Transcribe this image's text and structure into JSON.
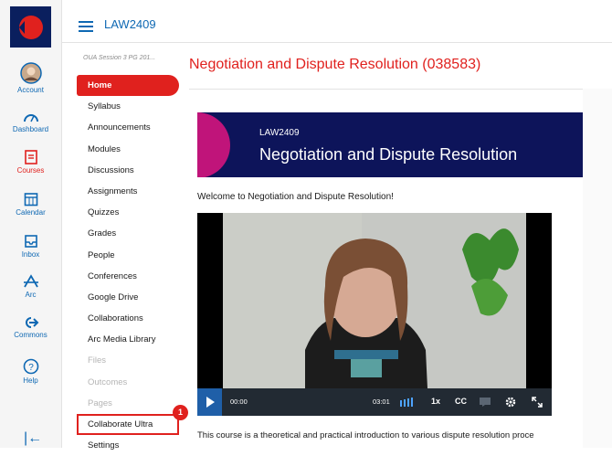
{
  "global_nav": {
    "items": [
      {
        "label": "Account",
        "icon": "account-avatar-icon"
      },
      {
        "label": "Dashboard",
        "icon": "dashboard-icon"
      },
      {
        "label": "Courses",
        "icon": "courses-icon"
      },
      {
        "label": "Calendar",
        "icon": "calendar-icon"
      },
      {
        "label": "Inbox",
        "icon": "inbox-icon"
      },
      {
        "label": "Arc",
        "icon": "arc-icon"
      },
      {
        "label": "Commons",
        "icon": "commons-icon"
      },
      {
        "label": "Help",
        "icon": "help-icon"
      }
    ],
    "active": "Courses",
    "colors": {
      "link": "#0e68b3",
      "active": "#e0211e",
      "logo_bg": "#0a1f5e"
    }
  },
  "header": {
    "breadcrumb": "LAW2409"
  },
  "course_nav": {
    "term": "OUA Session 3 PG 201...",
    "items": [
      {
        "label": "Home",
        "state": "active"
      },
      {
        "label": "Syllabus",
        "state": "normal"
      },
      {
        "label": "Announcements",
        "state": "normal"
      },
      {
        "label": "Modules",
        "state": "normal"
      },
      {
        "label": "Discussions",
        "state": "normal"
      },
      {
        "label": "Assignments",
        "state": "normal"
      },
      {
        "label": "Quizzes",
        "state": "normal"
      },
      {
        "label": "Grades",
        "state": "normal"
      },
      {
        "label": "People",
        "state": "normal"
      },
      {
        "label": "Conferences",
        "state": "normal"
      },
      {
        "label": "Google Drive",
        "state": "normal"
      },
      {
        "label": "Collaborations",
        "state": "normal"
      },
      {
        "label": "Arc Media Library",
        "state": "normal"
      },
      {
        "label": "Files",
        "state": "disabled"
      },
      {
        "label": "Outcomes",
        "state": "disabled"
      },
      {
        "label": "Pages",
        "state": "disabled"
      },
      {
        "label": "Collaborate Ultra",
        "state": "highlighted"
      },
      {
        "label": "Settings",
        "state": "normal"
      }
    ],
    "callout_number": "1"
  },
  "main": {
    "title": "Negotiation and Dispute Resolution (038583)",
    "banner": {
      "code": "LAW2409",
      "title": "Negotiation and Dispute Resolution"
    },
    "welcome": "Welcome to Negotiation and Dispute Resolution!",
    "video": {
      "current_time": "00:00",
      "duration": "03:01",
      "speed": "1x",
      "captions": "CC"
    },
    "body_text": "This course is a theoretical and practical introduction to various dispute resolution proce"
  }
}
